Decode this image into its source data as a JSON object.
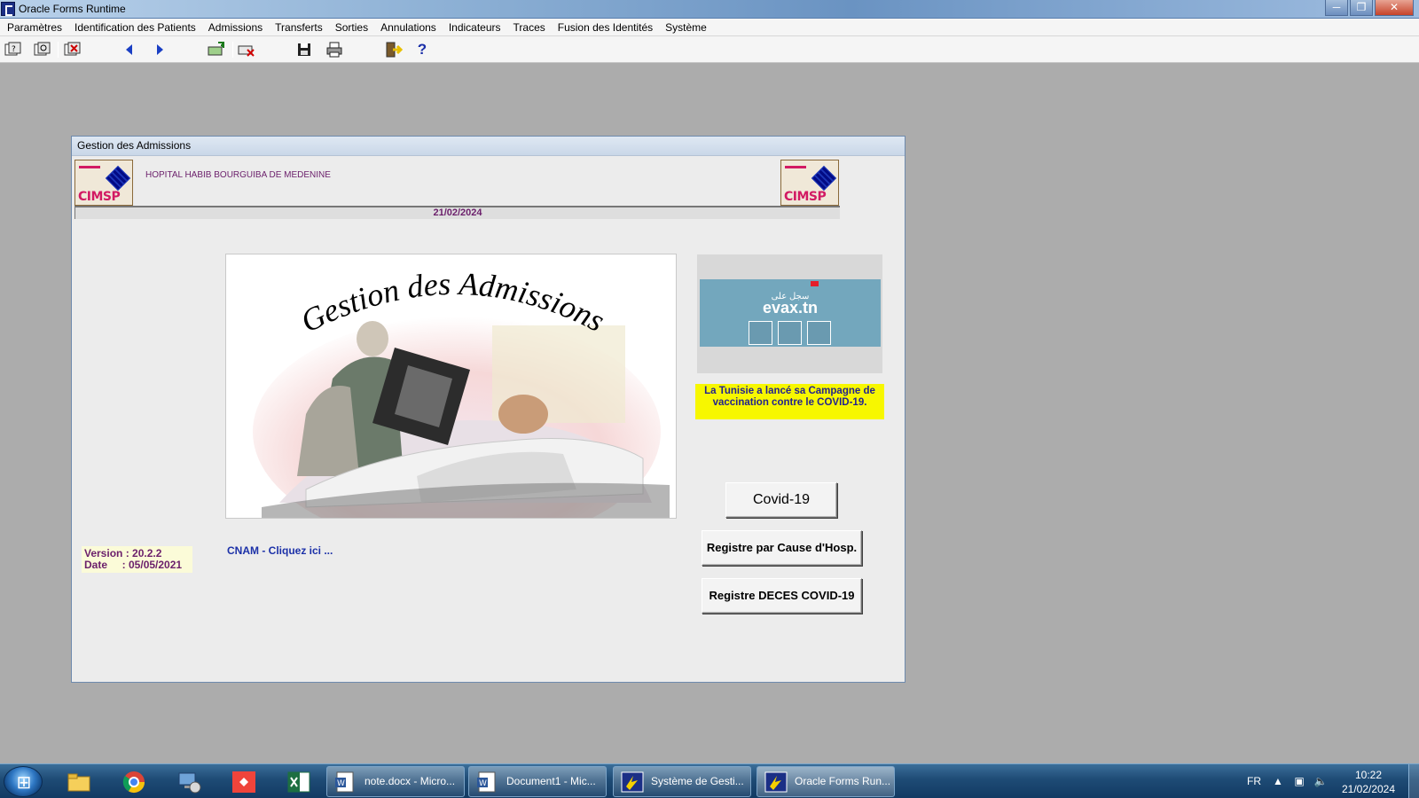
{
  "window": {
    "title": "Oracle Forms Runtime",
    "controls": [
      "─",
      "❐",
      "✕"
    ]
  },
  "menu": [
    "Paramètres",
    "Identification des Patients",
    "Admissions",
    "Transferts",
    "Sorties",
    "Annulations",
    "Indicateurs",
    "Traces",
    "Fusion des Identités",
    "Système"
  ],
  "toolbar": {
    "help_label": "?"
  },
  "form": {
    "title": "Gestion des Admissions",
    "hospital": "HOPITAL HABIB BOURGUIBA DE MEDENINE",
    "logo_text": "CIMSP",
    "date": "21/02/2024",
    "splash_title": "Gestion des Admissions",
    "evax": {
      "arabic": "سجل على",
      "brand": "evax.tn"
    },
    "covid_notice": "La  Tunisie  a lancé sa Campagne de vaccination contre le COVID-19.",
    "buttons": {
      "covid": "Covid-19",
      "registre_cause": "Registre par Cause d'Hosp.",
      "registre_deces": "Registre DECES  COVID-19"
    },
    "version_line": "Version : 20.2.2",
    "date_line": "Date     : 05/05/2021",
    "cnam_link": "CNAM - Cliquez ici ..."
  },
  "taskbar": {
    "tasks": [
      {
        "label": "note.docx - Micro..."
      },
      {
        "label": "Document1 - Mic..."
      },
      {
        "label": "Système de Gesti..."
      },
      {
        "label": "Oracle Forms Run..."
      }
    ],
    "lang": "FR",
    "time": "10:22",
    "date": "21/02/2024"
  },
  "colors": {
    "accent_purple": "#6b1f6b",
    "link_blue": "#1c31a8",
    "notice_yellow": "#f7f700",
    "evax_panel": "#73a7bd"
  }
}
